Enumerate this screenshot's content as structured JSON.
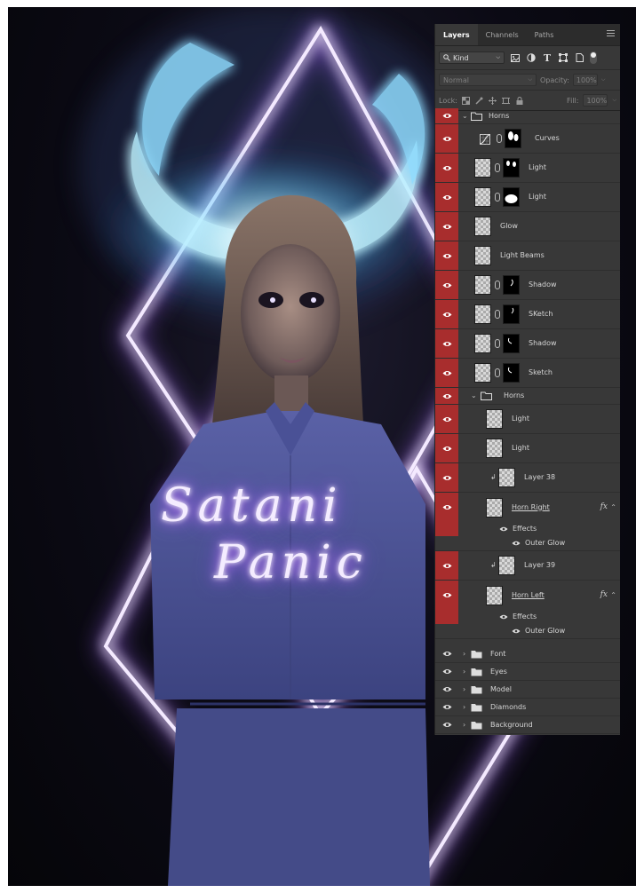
{
  "artwork": {
    "title_line1": "Satani",
    "title_line2": "Panic",
    "colors": {
      "neon_purple": "#b77bff",
      "neon_white": "#ffffff",
      "horn_cyan": "#6fe3ff",
      "shirt_blue": "#4d5596"
    }
  },
  "panel": {
    "tabs": [
      {
        "label": "Layers",
        "active": true
      },
      {
        "label": "Channels",
        "active": false
      },
      {
        "label": "Paths",
        "active": false
      }
    ],
    "menu_icon": "panel-menu-icon",
    "filter": {
      "kind_label": "Kind",
      "icons": [
        "image-filter-icon",
        "adjustment-filter-icon",
        "type-filter-icon",
        "shape-filter-icon",
        "smart-object-filter-icon"
      ]
    },
    "blend_mode": "Normal",
    "opacity_label": "Opacity:",
    "opacity_value": "100%",
    "lock_label": "Lock:",
    "fill_label": "Fill:",
    "fill_value": "100%",
    "layers": [
      {
        "name": "Horns",
        "kind": "group-open",
        "indent": 0
      },
      {
        "name": "Curves",
        "kind": "adjustment",
        "indent": 1
      },
      {
        "name": "Light",
        "kind": "layer-mask",
        "indent": 1
      },
      {
        "name": "Light",
        "kind": "layer-mask",
        "indent": 1
      },
      {
        "name": "Glow",
        "kind": "layer",
        "indent": 1
      },
      {
        "name": "Light Beams",
        "kind": "layer",
        "indent": 1
      },
      {
        "name": "Shadow",
        "kind": "layer-mask",
        "indent": 1
      },
      {
        "name": "SKetch",
        "kind": "layer-mask",
        "indent": 1
      },
      {
        "name": "Shadow",
        "kind": "layer-mask",
        "indent": 1
      },
      {
        "name": "Sketch",
        "kind": "layer-mask",
        "indent": 1
      },
      {
        "name": "Horns",
        "kind": "group-open",
        "indent": 1
      },
      {
        "name": "Light",
        "kind": "layer",
        "indent": 2
      },
      {
        "name": "Light",
        "kind": "layer",
        "indent": 2
      },
      {
        "name": "Layer 38",
        "kind": "clipped",
        "indent": 2
      },
      {
        "name": "Horn Right",
        "kind": "fx-layer",
        "indent": 2
      },
      {
        "name": "Effects",
        "kind": "effects",
        "indent": 2
      },
      {
        "name": "Outer Glow",
        "kind": "effect",
        "indent": 2
      },
      {
        "name": "Layer 39",
        "kind": "clipped",
        "indent": 2
      },
      {
        "name": "Horn Left",
        "kind": "fx-layer",
        "indent": 2
      },
      {
        "name": "Effects",
        "kind": "effects",
        "indent": 2
      },
      {
        "name": "Outer Glow",
        "kind": "effect",
        "indent": 2
      },
      {
        "name": "Font",
        "kind": "group-closed",
        "indent": 0
      },
      {
        "name": "Eyes",
        "kind": "group-closed",
        "indent": 0
      },
      {
        "name": "Model",
        "kind": "group-closed",
        "indent": 0
      },
      {
        "name": "Diamonds",
        "kind": "group-closed",
        "indent": 0
      },
      {
        "name": "Background",
        "kind": "group-closed",
        "indent": 0
      }
    ]
  }
}
